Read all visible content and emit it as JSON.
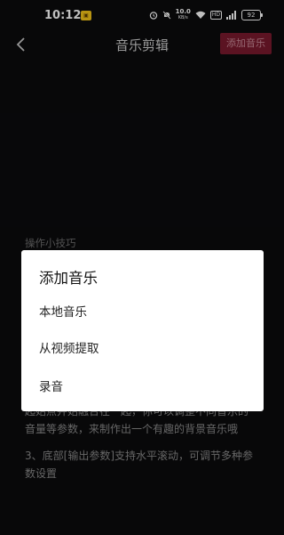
{
  "status_bar": {
    "time": "10:12",
    "network_speed": "10.0",
    "network_unit": "KB/s",
    "hd_label": "HD",
    "battery": "92"
  },
  "header": {
    "title": "音乐剪辑",
    "add_music_label": "添加音乐"
  },
  "tips": {
    "heading": "操作小技巧",
    "tip2_tail_line1": "起始点并始融合在一起，你可以调整不同音乐的",
    "tip2_tail_line2": "音量等参数，来制作出一个有趣的背景音乐哦",
    "tip3_line1": "3、底部[输出参数]支持水平滚动，可调节多种参",
    "tip3_line2": "数设置"
  },
  "dialog": {
    "title": "添加音乐",
    "options": [
      "本地音乐",
      "从视频提取",
      "录音"
    ]
  },
  "colors": {
    "background": "#0b0b0d",
    "accent_button": "#7a1a2e",
    "dialog_bg": "#ffffff"
  }
}
